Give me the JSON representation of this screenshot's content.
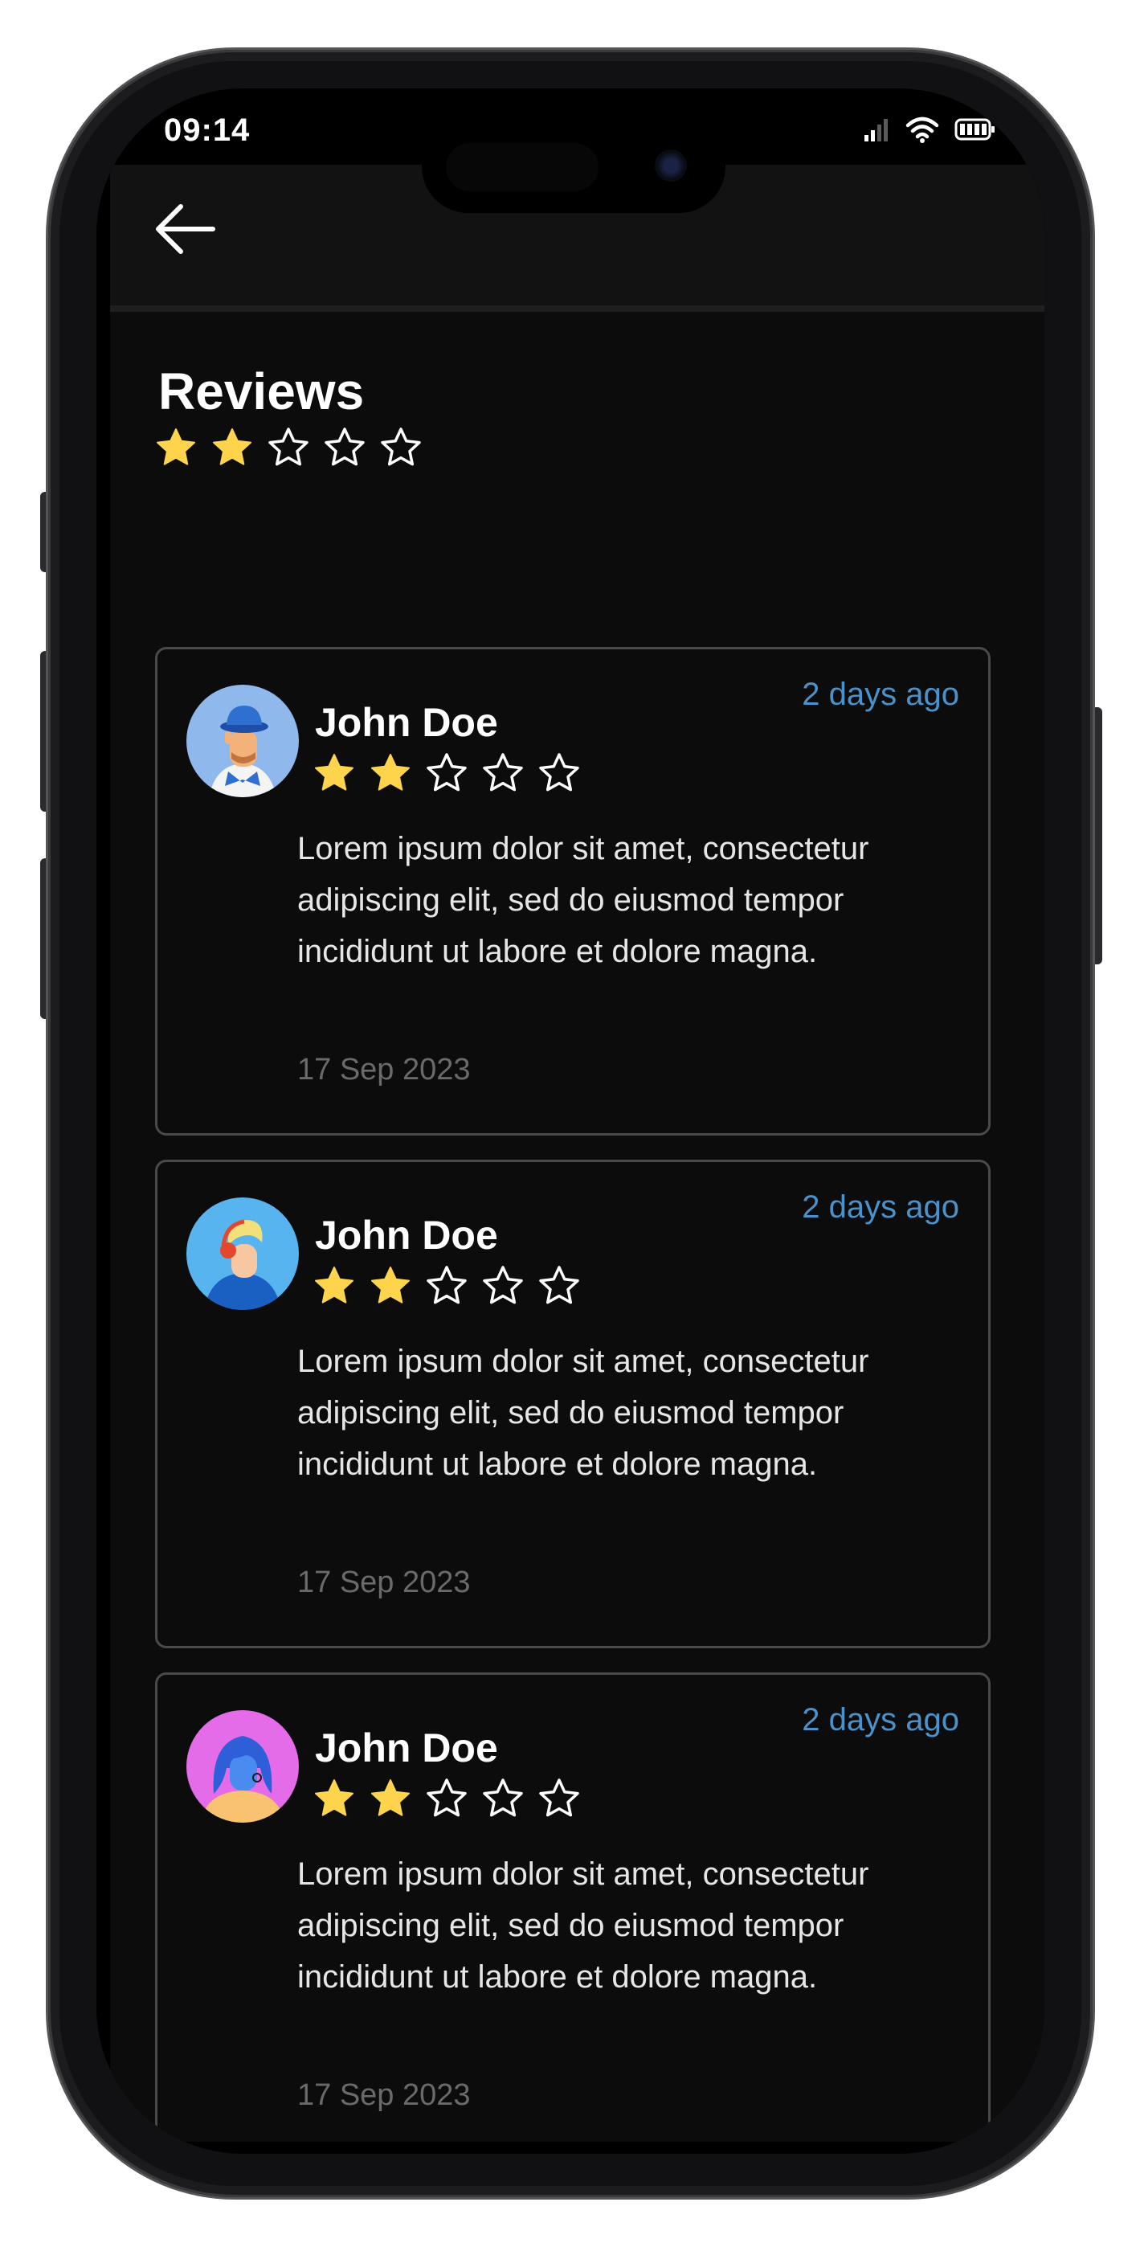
{
  "status_bar": {
    "time": "09:14"
  },
  "header": {
    "back_icon": "arrow-left-icon"
  },
  "reviews_section": {
    "title": "Reviews",
    "rating": 2,
    "max_rating": 5
  },
  "colors": {
    "star_filled": "#FFD44D",
    "star_outline": "#FFFFFF",
    "time_ago": "#4A92C9",
    "background": "#0C0C0D"
  },
  "reviews": [
    {
      "name": "John Doe",
      "rating": 2,
      "time_ago": "2 days ago",
      "text": "Lorem ipsum dolor sit amet, consectetur adipiscing elit, sed do eiusmod tempor incididunt ut labore et dolore magna.",
      "date": "17 Sep 2023",
      "avatar": "man-blue-hat-avatar"
    },
    {
      "name": "John Doe",
      "rating": 2,
      "time_ago": "2 days ago",
      "text": "Lorem ipsum dolor sit amet, consectetur adipiscing elit, sed do eiusmod tempor incididunt ut labore et dolore magna.",
      "date": "17 Sep 2023",
      "avatar": "man-headphones-avatar"
    },
    {
      "name": "John Doe",
      "rating": 2,
      "time_ago": "2 days ago",
      "text": "Lorem ipsum dolor sit amet, consectetur adipiscing elit, sed do eiusmod tempor incididunt ut labore et dolore magna.",
      "date": "17 Sep 2023",
      "avatar": "woman-blue-hair-avatar"
    }
  ]
}
